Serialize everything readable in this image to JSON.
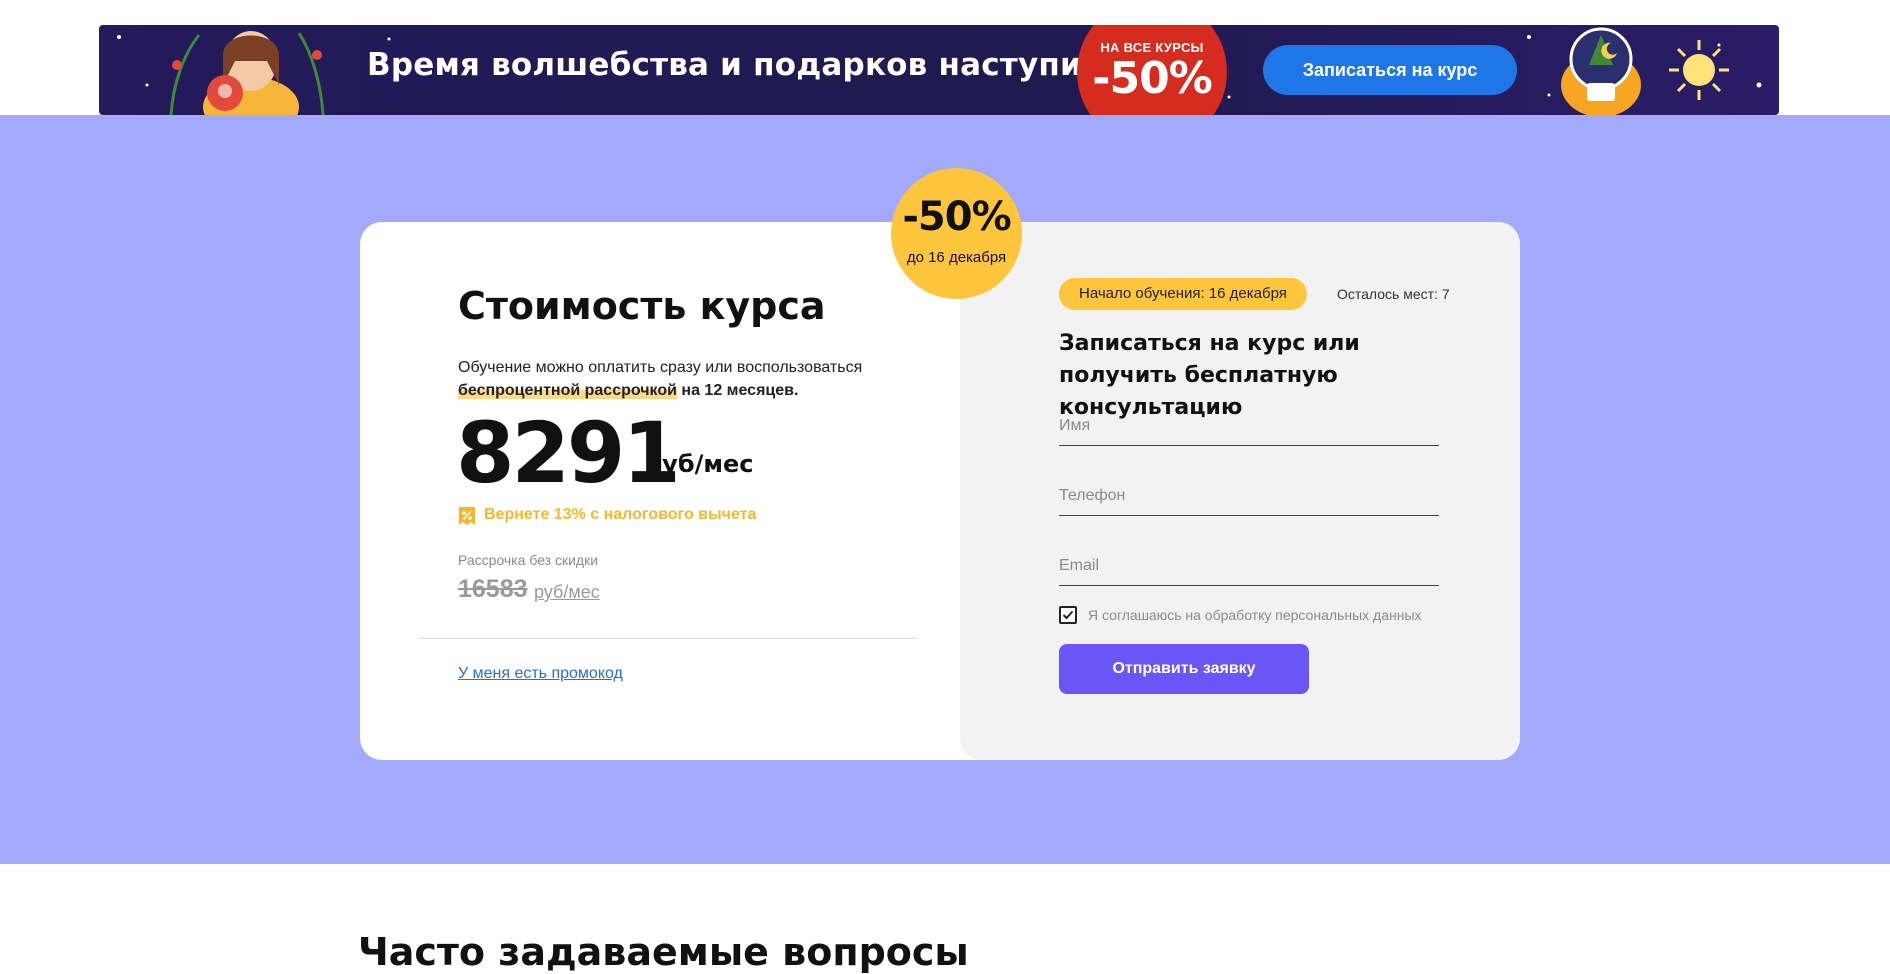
{
  "banner": {
    "headline": "Время волшебства и подарков наступило!",
    "sale_top": "НА ВСЕ КУРСЫ",
    "sale_value": "-50%",
    "cta_label": "Записаться на курс",
    "colors": {
      "background": "#241a5c",
      "sale_circle": "#d62b1f",
      "cta": "#1f76e6"
    }
  },
  "discount_badge": {
    "value": "-50%",
    "subtitle": "до 16 декабря",
    "color": "#ffc53d"
  },
  "pricing": {
    "title": "Стоимость курса",
    "description_prefix": "Обучение можно оплатить сразу или воспользоваться",
    "description_highlight": "беспроцентной рассрочкой",
    "description_suffix": "на 12 месяцев.",
    "price": "8291",
    "price_unit": "руб/мес",
    "tax_refund": "Вернете 13% с налогового вычета",
    "tax_icon": "percent-tag-icon",
    "installment_label": "Рассрочка без скидки",
    "old_price": "16583",
    "old_price_unit": "руб/мес",
    "promo_link": "У меня есть промокод"
  },
  "form": {
    "start_date": "Начало обучения: 16 декабря",
    "seats_left": "Осталось мест: 7",
    "title": "Записаться на курс или получить бесплатную консультацию",
    "name_placeholder": "Имя",
    "phone_placeholder": "Телефон",
    "email_placeholder": "Email",
    "consent_label": "Я соглашаюсь на обработку персональных данных",
    "consent_checked": true,
    "submit_label": "Отправить заявку",
    "submit_color": "#6b55f6"
  },
  "section_background": "#a3a9fb",
  "faq": {
    "title": "Часто задаваемые вопросы"
  }
}
